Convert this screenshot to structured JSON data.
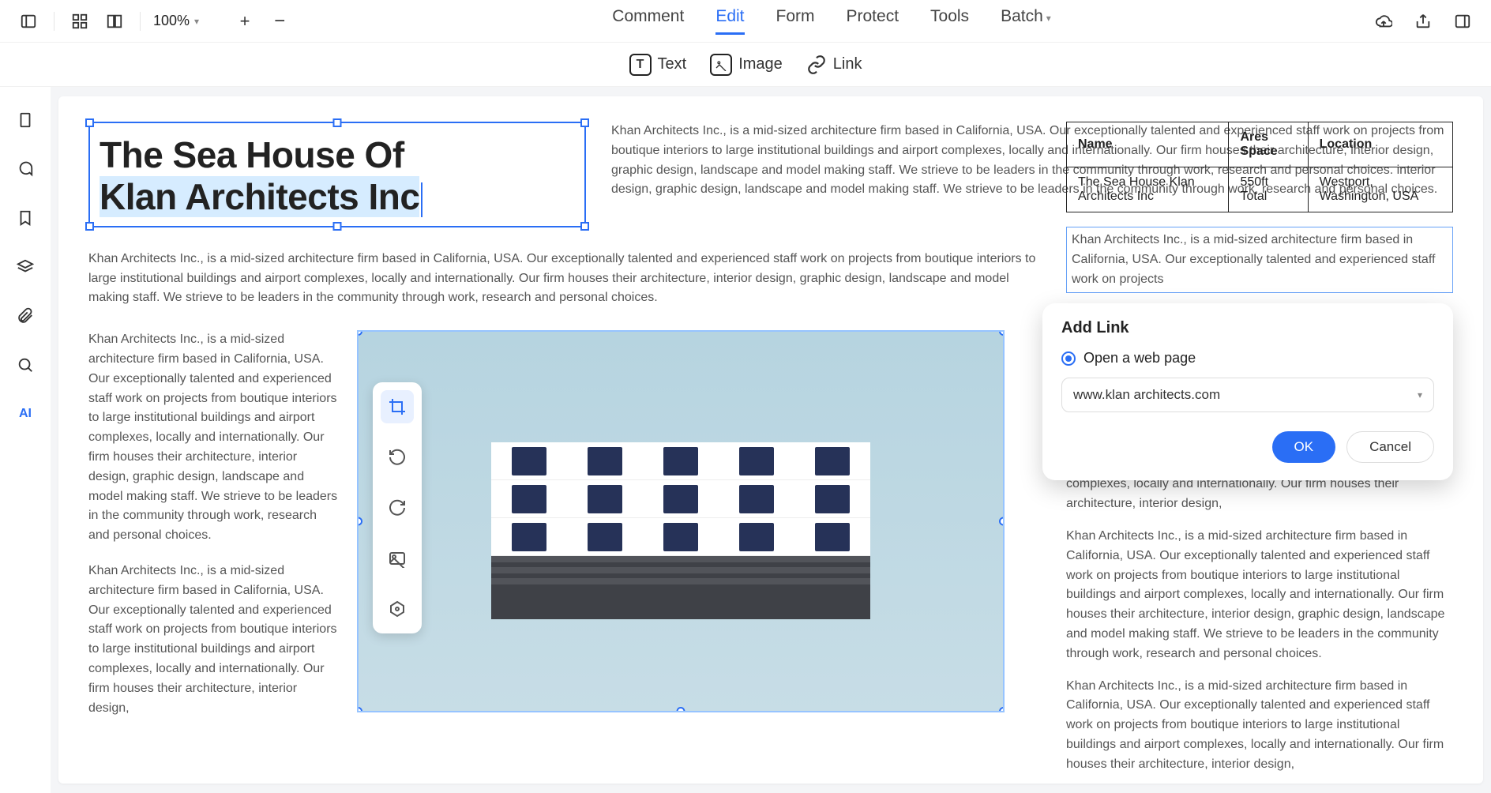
{
  "toolbar": {
    "zoom": "100%",
    "tabs": [
      "Comment",
      "Edit",
      "Form",
      "Protect",
      "Tools",
      "Batch"
    ],
    "active_tab": "Edit"
  },
  "subbar": {
    "text": "Text",
    "image": "Image",
    "link": "Link"
  },
  "sidebar_icons": [
    "pages-icon",
    "comments-icon",
    "bookmark-icon",
    "layers-icon",
    "attachment-icon",
    "search-icon",
    "ai-icon"
  ],
  "document": {
    "title_line1": "The Sea House Of",
    "title_line2": "Klan Architects Inc",
    "para_top_right": "Khan Architects Inc., is a mid-sized architecture firm based in California, USA. Our exceptionally talented and experienced staff work on projects from boutique interiors to large institutional buildings and airport complexes, locally and internationally. Our firm houses their architecture, interior design, graphic design, landscape and model making staff. We strieve to be leaders in the community through work, research and personal choices. interior design, graphic design, landscape and model making staff. We strieve to be leaders in the community through work, research and personal choices.",
    "para_full": "Khan Architects Inc., is a mid-sized architecture firm based in California, USA. Our exceptionally talented and experienced staff work on projects from boutique interiors to large institutional buildings and airport complexes, locally and internationally. Our firm houses their architecture, interior design, graphic design, landscape and model making staff. We strieve to be leaders in the community through work, research and personal choices.",
    "para_left_1": "Khan Architects Inc., is a mid-sized architecture firm based in California, USA. Our exceptionally talented and experienced staff work on projects from boutique interiors to large institutional buildings and airport complexes, locally and internationally. Our firm houses their architecture, interior design, graphic design, landscape and model making staff. We strieve to be leaders in the community through work, research and personal choices.",
    "para_left_2": "Khan Architects Inc., is a mid-sized architecture firm based in California, USA. Our exceptionally talented and experienced staff work on projects from boutique interiors to large institutional buildings and airport complexes, locally and internationally. Our firm houses their architecture, interior design,"
  },
  "info_table": {
    "headers": [
      "Name",
      "Ares Space",
      "Location"
    ],
    "row": [
      "The Sea House Klan Architects Inc",
      "550ft Total",
      "Westport, Washington, USA"
    ]
  },
  "side": {
    "linked_text": "Khan Architects Inc., is a mid-sized architecture firm based in California, USA. Our exceptionally talented and experienced staff work on projects",
    "para1": "complexes, locally and internationally. Our firm houses their architecture, interior design,",
    "para2": "Khan Architects Inc., is a mid-sized architecture firm based in California, USA. Our exceptionally talented and experienced staff work on projects from boutique interiors to large institutional buildings and airport complexes, locally and internationally. Our firm houses their architecture, interior design, graphic design, landscape and model making staff. We strieve to be leaders in the community through work, research and personal choices.",
    "para3": "Khan Architects Inc., is a mid-sized architecture firm based in California, USA. Our exceptionally talented and experienced staff work on projects from boutique interiors to large institutional buildings and airport complexes, locally and internationally. Our firm houses their architecture, interior design,"
  },
  "popover": {
    "title": "Add Link",
    "option": "Open a web page",
    "url": "www.klan architects.com",
    "ok": "OK",
    "cancel": "Cancel"
  }
}
